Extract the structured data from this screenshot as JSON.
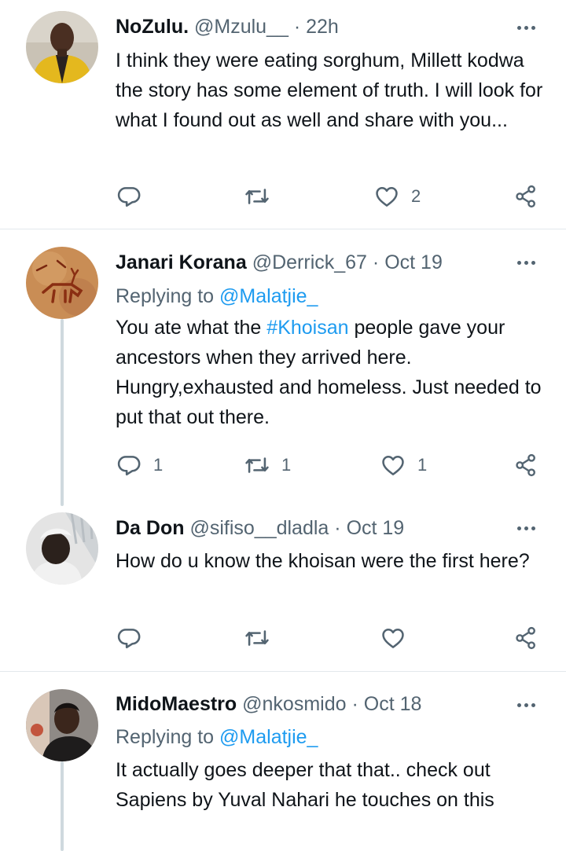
{
  "colors": {
    "accent": "#1d9bf0",
    "secondary_text": "#536471",
    "divider": "#e3e8ec"
  },
  "tweets": [
    {
      "name": "NoZulu.",
      "handle": "@Mzulu__",
      "dot": "·",
      "time": "22h",
      "body": "I think they were eating sorghum, Millett kodwa the story has some element of truth. I will look for what I found out as well and share with you...",
      "reply_count": "",
      "retweet_count": "",
      "like_count": "2"
    },
    {
      "name": "Janari Korana",
      "handle": "@Derrick_67",
      "dot": "·",
      "time": "Oct 19",
      "replying_prefix": "Replying to",
      "replying_to": "@Malatjie_",
      "body_before": "You ate what the ",
      "hashtag": "#Khoisan",
      "body_after": " people gave your ancestors when they arrived here. Hungry,exhausted and homeless. Just needed to put that out there.",
      "reply_count": "1",
      "retweet_count": "1",
      "like_count": "1"
    },
    {
      "name": "Da Don",
      "handle": "@sifiso__dladla",
      "dot": "·",
      "time": "Oct 19",
      "body": "How do u know the khoisan were the first here?",
      "reply_count": "",
      "retweet_count": "",
      "like_count": ""
    },
    {
      "name": "MidoMaestro",
      "handle": "@nkosmido",
      "dot": "·",
      "time": "Oct 18",
      "replying_prefix": "Replying to",
      "replying_to": "@Malatjie_",
      "body": "It actually goes deeper that that.. check out Sapiens by Yuval Nahari he touches on this"
    }
  ],
  "icons": {
    "reply": "reply-icon",
    "retweet": "retweet-icon",
    "like": "heart-icon",
    "share": "share-icon",
    "more": "more-icon"
  }
}
